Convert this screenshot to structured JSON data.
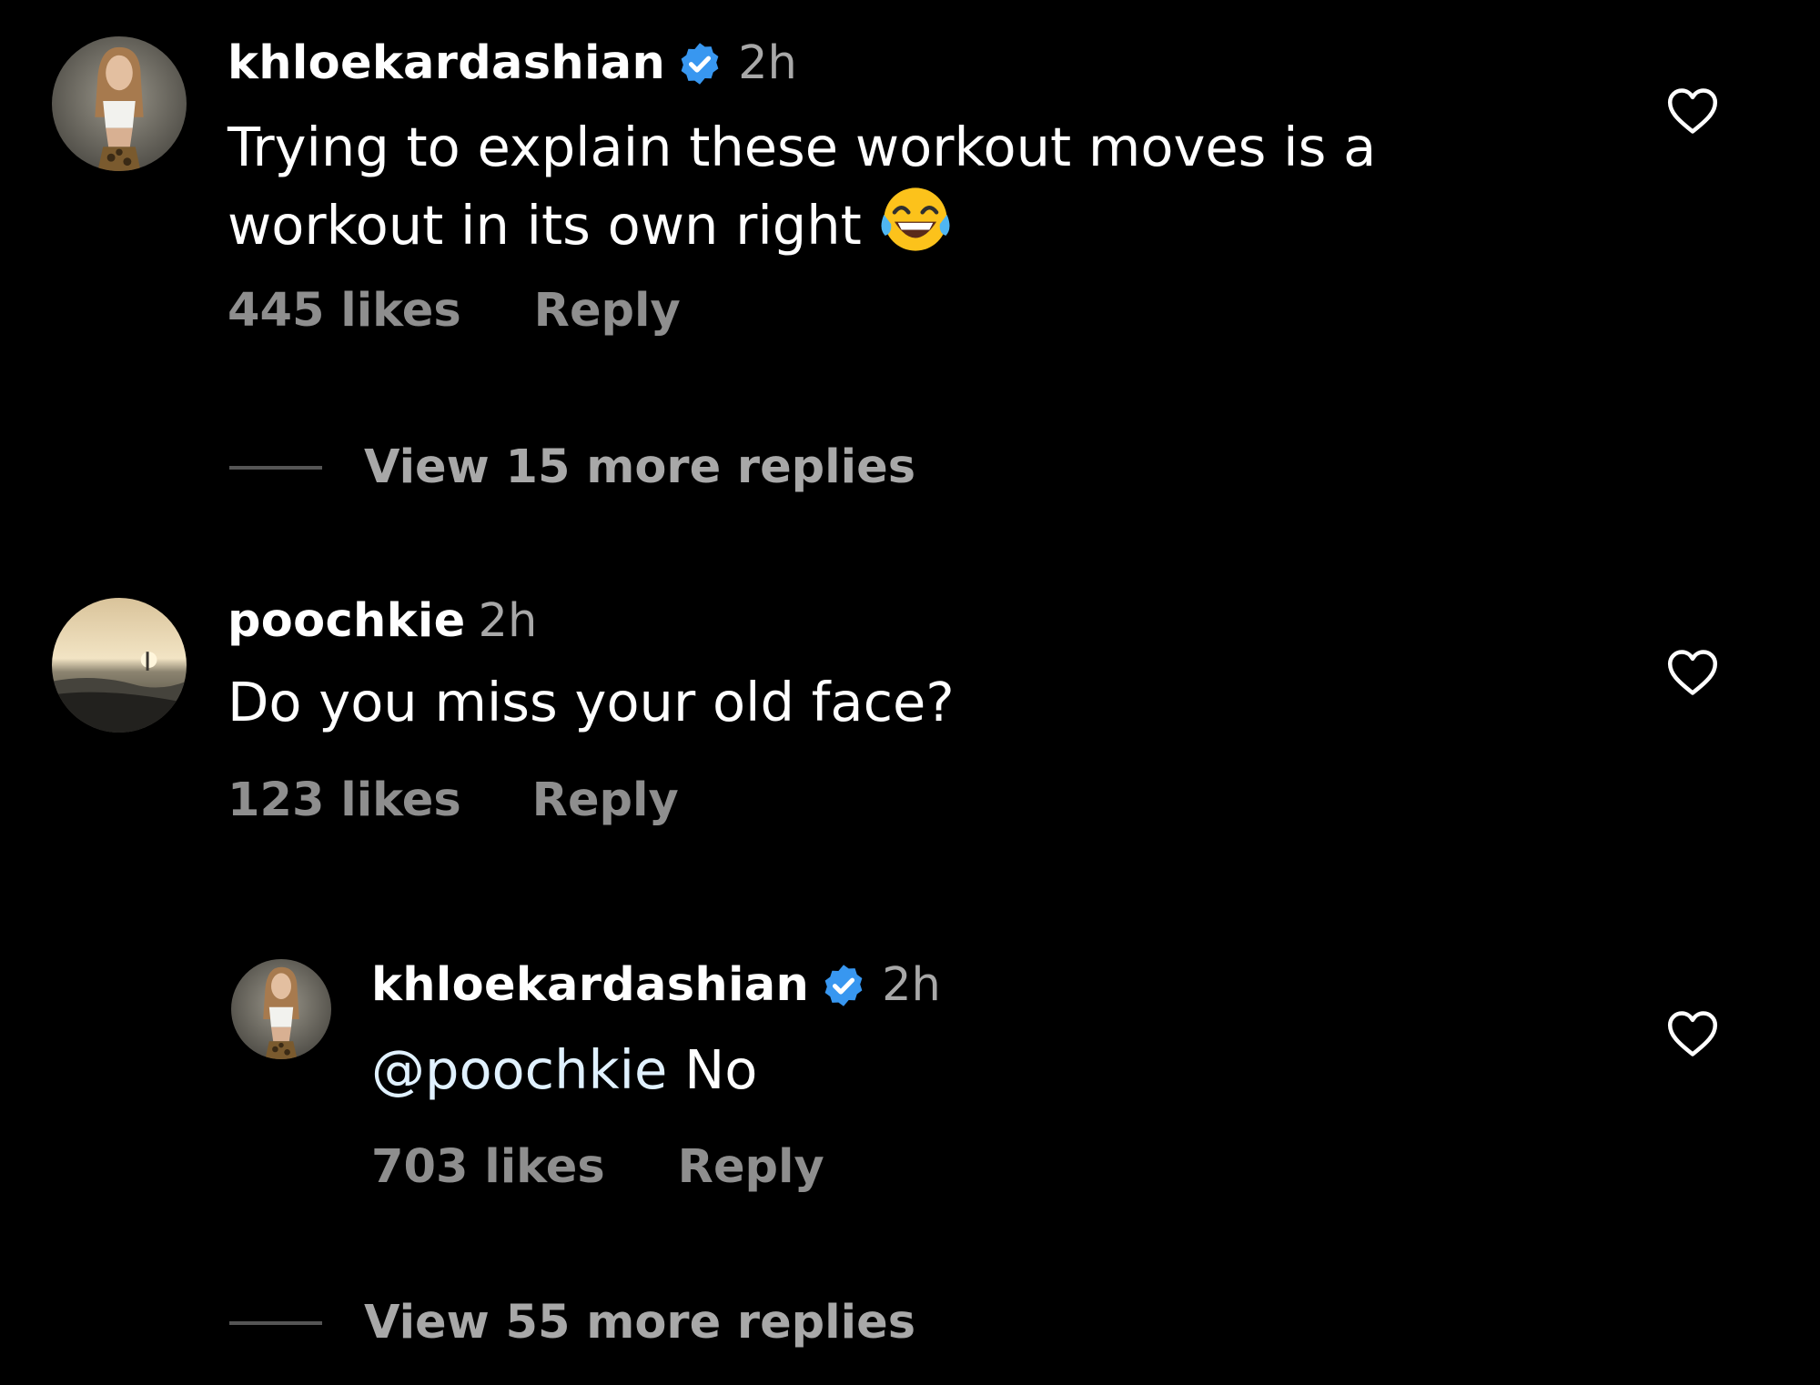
{
  "comments": [
    {
      "username": "khloekardashian",
      "verified": true,
      "time": "2h",
      "text_line1": "Trying to explain these workout moves is a",
      "text_line2": "workout in its own right",
      "emoji": "face-with-tears-of-joy",
      "likes": "445 likes",
      "reply_label": "Reply",
      "view_more": "View 15 more replies"
    },
    {
      "username": "poochkie",
      "verified": false,
      "time": "2h",
      "text": "Do you miss your old face?",
      "likes": "123 likes",
      "reply_label": "Reply",
      "replies": [
        {
          "username": "khloekardashian",
          "verified": true,
          "time": "2h",
          "mention": "@poochkie",
          "text": "No",
          "likes": "703 likes",
          "reply_label": "Reply"
        }
      ],
      "view_more": "View 55 more replies"
    }
  ],
  "colors": {
    "background": "#000000",
    "primary_text": "#ffffff",
    "secondary_text": "#8e8e8e",
    "verified_badge": "#3897f0",
    "divider": "#555555"
  },
  "icons": {
    "like": "heart-outline-icon",
    "verified": "verified-badge-icon"
  }
}
